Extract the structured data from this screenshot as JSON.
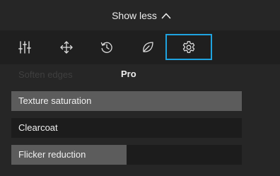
{
  "header": {
    "toggle_label": "Show less",
    "toggle_icon": "chevron-up-icon"
  },
  "toolbar": {
    "tools": [
      {
        "name": "adjustments",
        "icon": "sliders-icon",
        "active": false
      },
      {
        "name": "transform",
        "icon": "move-arrows-icon",
        "active": false
      },
      {
        "name": "history",
        "icon": "history-icon",
        "active": false
      },
      {
        "name": "nature",
        "icon": "leaf-icon",
        "active": false
      },
      {
        "name": "settings",
        "icon": "gear-icon",
        "active": true
      }
    ],
    "active_color": "#1fa3e0"
  },
  "sections": {
    "soften_label": "Soften edges",
    "pro_label": "Pro"
  },
  "sliders": [
    {
      "label": "Texture saturation",
      "value": 1.0
    },
    {
      "label": "Clearcoat",
      "value": 0.0
    },
    {
      "label": "Flicker reduction",
      "value": 0.5
    }
  ]
}
